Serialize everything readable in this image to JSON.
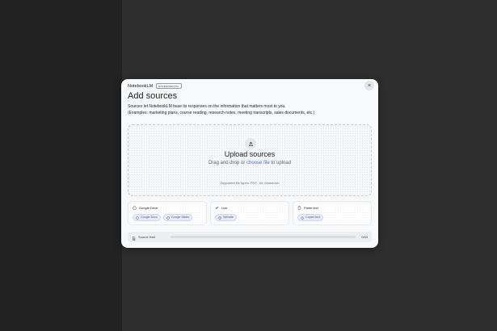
{
  "app": {
    "brand": "NotebookLM",
    "badge": "EXPERIMENTAL"
  },
  "dialog": {
    "close_glyph": "×",
    "title": "Add sources",
    "description_line1": "Sources let NotebookLM base its responses on the information that matters most to you.",
    "description_line2": "(Examples: marketing plans, course reading, research notes, meeting transcripts, sales documents, etc.)"
  },
  "upload": {
    "icon": "upload-icon",
    "title": "Upload sources",
    "drag_text": "Drag and drop or ",
    "choose_link": "choose file",
    "to_upload": " to upload",
    "supported": "Supported file types: PDF, .txt, Markdown"
  },
  "cards": [
    {
      "icon": "google-drive-icon",
      "label": "Google Drive",
      "chips": [
        {
          "icon": "docs-icon",
          "label": "Google Docs"
        },
        {
          "icon": "slides-icon",
          "label": "Google Slides"
        }
      ]
    },
    {
      "icon": "link-icon",
      "label": "Link",
      "chips": [
        {
          "icon": "globe-icon",
          "label": "Website"
        }
      ]
    },
    {
      "icon": "clipboard-icon",
      "label": "Paste text",
      "chips": [
        {
          "icon": "copy-icon",
          "label": "Copied text"
        }
      ]
    }
  ],
  "limit": {
    "label": "Source limit",
    "count": "0/50",
    "fraction": 0.0
  },
  "colors": {
    "accent": "#4a6ee0",
    "modal_bg": "#f8f9fb",
    "backdrop": "#2e2e2e"
  }
}
